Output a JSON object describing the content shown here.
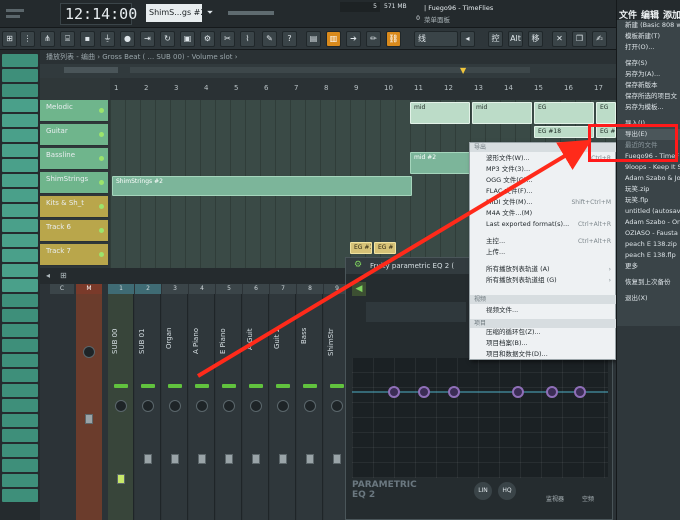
{
  "topbar": {
    "time": "12:14:00",
    "pattern": "ShimS...gs #2",
    "pattern_arrow": "⏷",
    "bpm": "5",
    "memory": "571 MB",
    "mem_zero": "0",
    "project_title": "| Fuego96 - TimeFlies",
    "subtitle": "菜单面板"
  },
  "toolbar": {
    "snap_label": "线",
    "btn_labels": [
      "控",
      "Alt",
      "移"
    ]
  },
  "browser": {
    "colors": [
      "#3e8f7a",
      "#3e8f7a",
      "#3e8f7a",
      "#4aa08a",
      "#4aa08a",
      "#4aa08a",
      "#4aa08a",
      "#4aa08a",
      "#4aa08a",
      "#4aa08a",
      "#4aa08a",
      "#4aa08a",
      "#4aa08a",
      "#4aa08a",
      "#4aa08a",
      "#4aa08a",
      "#3e8f7a",
      "#3e8f7a",
      "#3e8f7a",
      "#3e8f7a",
      "#3e8f7a",
      "#3e8f7a",
      "#3e8f7a",
      "#3e8f7a",
      "#3e8f7a",
      "#3e8f7a",
      "#3e8f7a",
      "#3e8f7a",
      "#3e8f7a",
      "#3e8f7a"
    ]
  },
  "playlist": {
    "title": "播放列表 - 编曲 › Gross Beat ( ... SUB 00) - Volume slot ›",
    "ruler": [
      "1",
      "2",
      "3",
      "4",
      "5",
      "6",
      "7",
      "8",
      "9",
      "10",
      "11",
      "12",
      "13",
      "14",
      "15",
      "16",
      "17"
    ],
    "tracks": [
      {
        "name": "Melodic",
        "color": "#6fb58c"
      },
      {
        "name": "Guitar",
        "color": "#6fb58c"
      },
      {
        "name": "Bassline",
        "color": "#6fb58c"
      },
      {
        "name": "ShimStrings",
        "color": "#6fb58c"
      },
      {
        "name": "Kits & Sh_t",
        "color": "#b9a64b"
      },
      {
        "name": "Track 6",
        "color": "#b9a64b"
      },
      {
        "name": "Track 7",
        "color": "#b9a64b"
      }
    ],
    "clips": {
      "mid1": "mid",
      "mid2": "mid",
      "eg1": "EG",
      "eg2": "EG",
      "eg3": "EG #18",
      "eg4": "EG #18",
      "mid3": "mid #2",
      "shim": "ShimStrings #2",
      "eg13": "EG #13",
      "egkit": "EG #"
    }
  },
  "mixer": {
    "header_m": "M",
    "header_c": "C",
    "channels": [
      {
        "num": "1",
        "label": "SUB 00"
      },
      {
        "num": "2",
        "label": "SUB 01"
      },
      {
        "num": "3",
        "label": "Organ"
      },
      {
        "num": "4",
        "label": "A Piano"
      },
      {
        "num": "5",
        "label": "E Piano"
      },
      {
        "num": "6",
        "label": "A Guit"
      },
      {
        "num": "7",
        "label": "Guit 2"
      },
      {
        "num": "8",
        "label": "Bass"
      },
      {
        "num": "9",
        "label": "ShimStr"
      }
    ]
  },
  "eq": {
    "title": "Fruity parametric EQ 2 (",
    "footer": "PARAMETRIC EQ 2",
    "btn_lin": "LIN",
    "btn_hq": "HQ",
    "label_a": "监视器",
    "label_b": "空频"
  },
  "context_menu": {
    "section_top": "导出",
    "items": [
      {
        "label": "波形文件(W)...",
        "shortcut": "Ctrl+R"
      },
      {
        "label": "MP3 文件(3)...",
        "shortcut": ""
      },
      {
        "label": "OGG 文件(G)...",
        "shortcut": ""
      },
      {
        "label": "FLAC 文件(F)...",
        "shortcut": ""
      },
      {
        "label": "MIDI 文件(M)...",
        "shortcut": "Shift+Ctrl+M"
      },
      {
        "label": "M4A 文件...(M)",
        "shortcut": ""
      },
      {
        "label": "Last exported format(s)...",
        "shortcut": "Ctrl+Alt+R"
      },
      {
        "label": "主控...",
        "shortcut": "Ctrl+Alt+R"
      },
      {
        "label": "上传...",
        "shortcut": ""
      },
      {
        "label": "所有播放列表轨道 (A)",
        "shortcut": "›"
      },
      {
        "label": "所有播放列表轨道组 (G)",
        "shortcut": "›"
      }
    ],
    "section_video": "视频",
    "video_item": "视频文件...",
    "section_pack": "项目",
    "pack_items": [
      "压缩的循环包(Z)...",
      "项目档案(B)...",
      "项目和数据文件(D)..."
    ]
  },
  "file_menu": {
    "headers": [
      "文件",
      "编辑",
      "添加"
    ],
    "items": [
      "新建 (Basic 808 w",
      "模板新建(T)",
      "打开(O)...",
      "",
      "保存(S)",
      "另存为(A)...",
      "保存新版本",
      "保存所选的项目文",
      "另存为模板...",
      "",
      "导入(I)",
      "导出(E)",
      "最近的文件",
      "Fuego96 - TimeF",
      "9loops - Keep It S",
      "Adam Szabo & Jo",
      "玩笑.zip",
      "玩笑.flp",
      "untitled (autosave",
      "Adam Szabo - On",
      "OZIASO - Fausta f",
      "peach E 138.zip",
      "peach E 138.flp",
      "更多",
      "",
      "恢复到上次备份",
      "",
      "退出(X)"
    ]
  },
  "colors": {
    "accent": "#d98a1c",
    "arrow": "#ff2a1a",
    "menu_bg": "#eef1f3"
  }
}
